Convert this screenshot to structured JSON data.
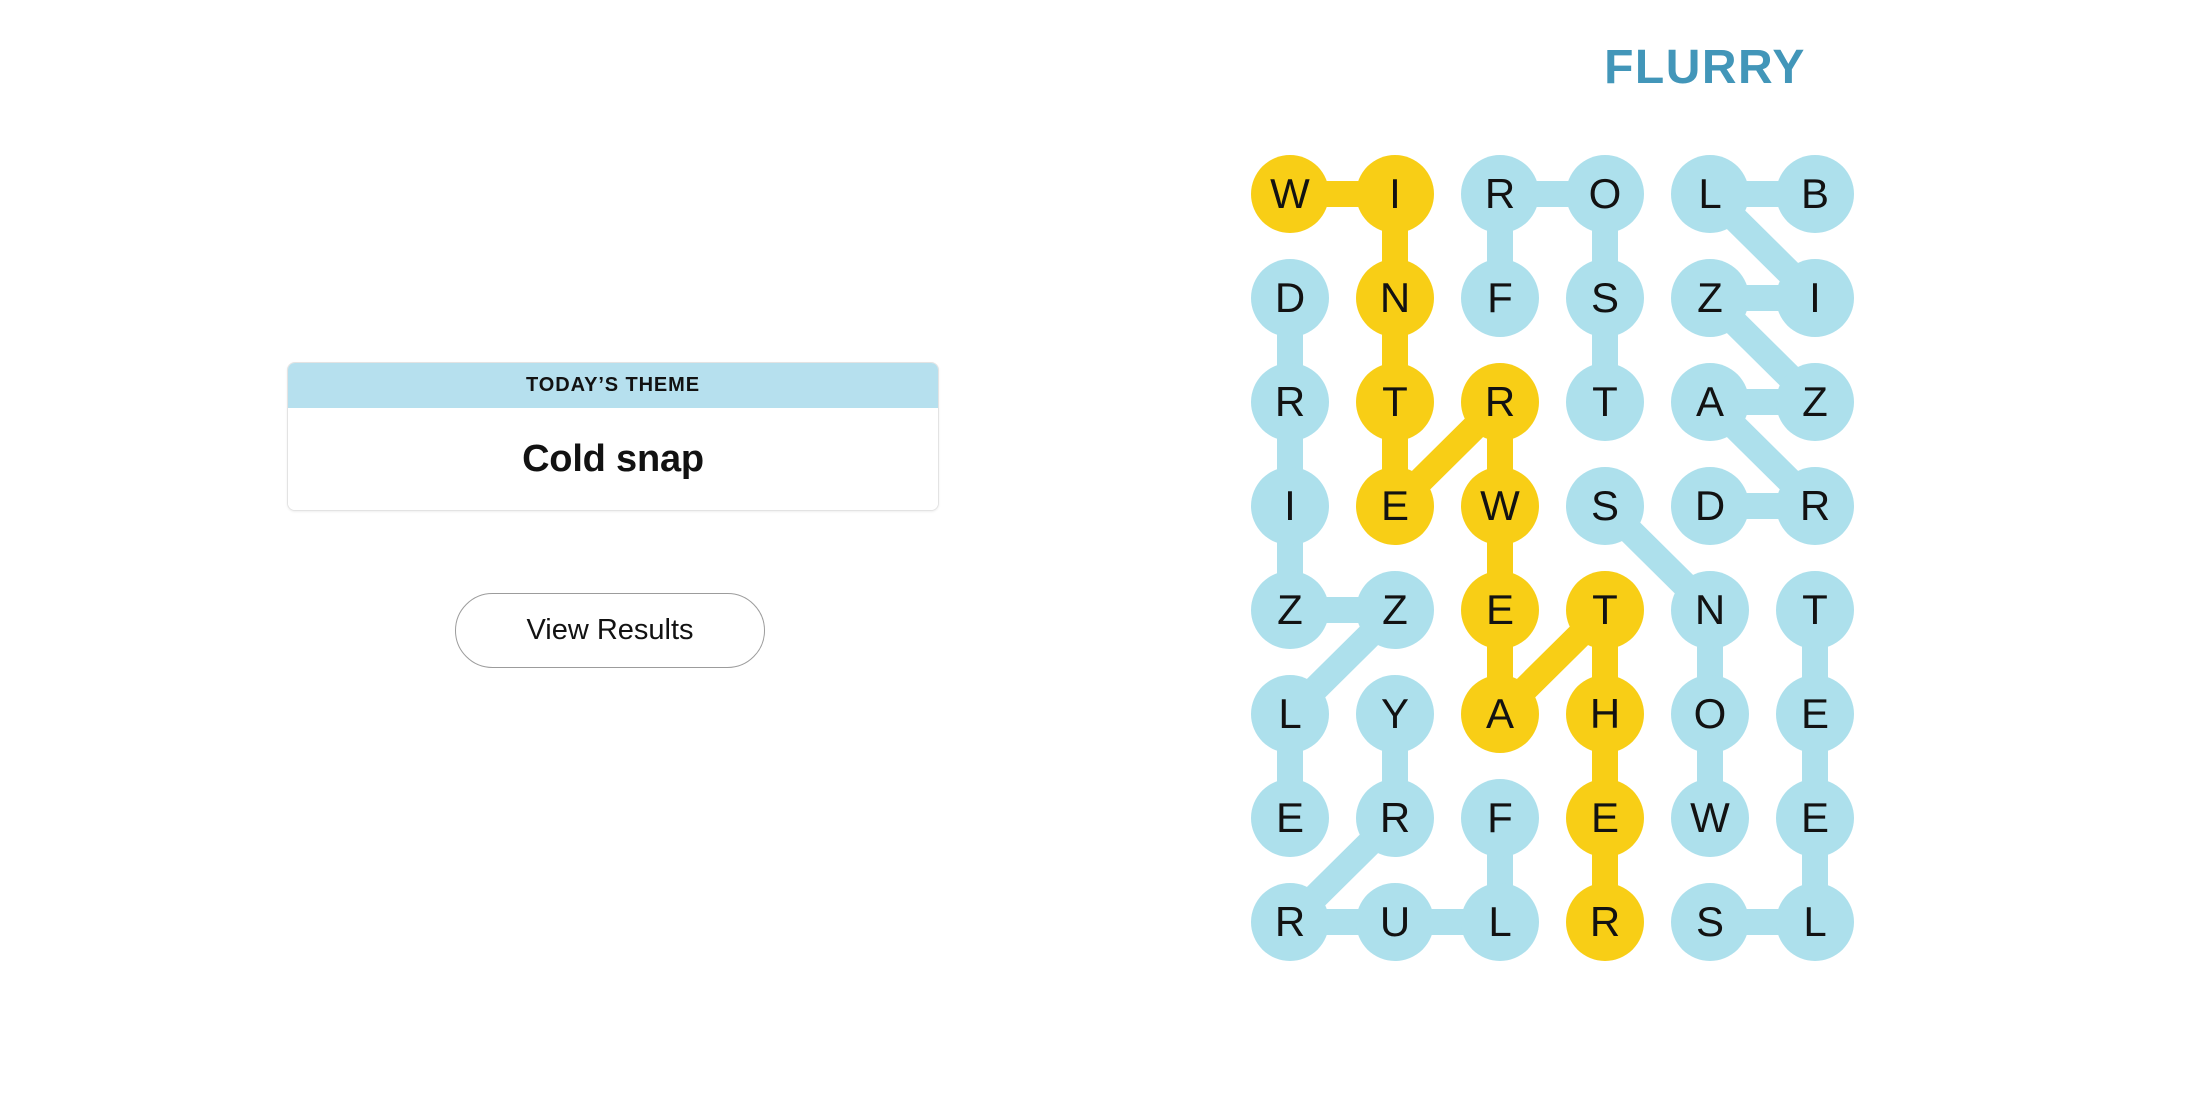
{
  "puzzle": {
    "title": "FLURRY",
    "title_color": "#4296b9",
    "colors": {
      "found_blue": "#ade0ec",
      "theme_yellow": "#f8ce16",
      "header_blue": "#b6e0ee",
      "text": "#121212"
    },
    "grid": {
      "rows": 8,
      "cols": 6,
      "letters": [
        [
          "W",
          "I",
          "R",
          "O",
          "L",
          "B"
        ],
        [
          "D",
          "N",
          "F",
          "S",
          "Z",
          "I"
        ],
        [
          "R",
          "T",
          "R",
          "T",
          "A",
          "Z"
        ],
        [
          "I",
          "E",
          "W",
          "S",
          "D",
          "R"
        ],
        [
          "Z",
          "Z",
          "E",
          "T",
          "N",
          "T"
        ],
        [
          "L",
          "Y",
          "A",
          "H",
          "O",
          "E"
        ],
        [
          "E",
          "R",
          "F",
          "E",
          "W",
          "E"
        ],
        [
          "R",
          "U",
          "L",
          "R",
          "S",
          "L"
        ]
      ],
      "highlight": [
        [
          1,
          1,
          0,
          0,
          0,
          0
        ],
        [
          0,
          1,
          0,
          0,
          0,
          0
        ],
        [
          0,
          1,
          1,
          0,
          0,
          0
        ],
        [
          0,
          1,
          1,
          0,
          0,
          0
        ],
        [
          0,
          0,
          1,
          1,
          0,
          0
        ],
        [
          0,
          0,
          1,
          1,
          0,
          0
        ],
        [
          0,
          0,
          0,
          1,
          0,
          0
        ],
        [
          0,
          0,
          0,
          1,
          0,
          0
        ]
      ],
      "links": [
        {
          "from": [
            0,
            0
          ],
          "to": [
            0,
            1
          ],
          "kind": "theme"
        },
        {
          "from": [
            0,
            1
          ],
          "to": [
            1,
            1
          ],
          "kind": "theme"
        },
        {
          "from": [
            1,
            1
          ],
          "to": [
            2,
            1
          ],
          "kind": "theme"
        },
        {
          "from": [
            2,
            1
          ],
          "to": [
            3,
            1
          ],
          "kind": "theme"
        },
        {
          "from": [
            3,
            1
          ],
          "to": [
            2,
            2
          ],
          "kind": "theme"
        },
        {
          "from": [
            2,
            2
          ],
          "to": [
            3,
            2
          ],
          "kind": "theme"
        },
        {
          "from": [
            3,
            2
          ],
          "to": [
            4,
            2
          ],
          "kind": "theme"
        },
        {
          "from": [
            4,
            2
          ],
          "to": [
            5,
            2
          ],
          "kind": "theme"
        },
        {
          "from": [
            5,
            2
          ],
          "to": [
            4,
            3
          ],
          "kind": "theme"
        },
        {
          "from": [
            4,
            3
          ],
          "to": [
            5,
            3
          ],
          "kind": "theme"
        },
        {
          "from": [
            5,
            3
          ],
          "to": [
            6,
            3
          ],
          "kind": "theme"
        },
        {
          "from": [
            6,
            3
          ],
          "to": [
            7,
            3
          ],
          "kind": "theme"
        },
        {
          "from": [
            0,
            2
          ],
          "to": [
            0,
            3
          ],
          "kind": "found"
        },
        {
          "from": [
            0,
            2
          ],
          "to": [
            1,
            2
          ],
          "kind": "found"
        },
        {
          "from": [
            0,
            3
          ],
          "to": [
            1,
            3
          ],
          "kind": "found"
        },
        {
          "from": [
            1,
            3
          ],
          "to": [
            2,
            3
          ],
          "kind": "found"
        },
        {
          "from": [
            0,
            4
          ],
          "to": [
            0,
            5
          ],
          "kind": "found"
        },
        {
          "from": [
            0,
            4
          ],
          "to": [
            1,
            5
          ],
          "kind": "found"
        },
        {
          "from": [
            1,
            5
          ],
          "to": [
            1,
            4
          ],
          "kind": "found"
        },
        {
          "from": [
            1,
            4
          ],
          "to": [
            2,
            5
          ],
          "kind": "found"
        },
        {
          "from": [
            2,
            5
          ],
          "to": [
            2,
            4
          ],
          "kind": "found"
        },
        {
          "from": [
            2,
            4
          ],
          "to": [
            3,
            5
          ],
          "kind": "found"
        },
        {
          "from": [
            3,
            5
          ],
          "to": [
            3,
            4
          ],
          "kind": "found"
        },
        {
          "from": [
            3,
            3
          ],
          "to": [
            4,
            4
          ],
          "kind": "found"
        },
        {
          "from": [
            4,
            4
          ],
          "to": [
            5,
            4
          ],
          "kind": "found"
        },
        {
          "from": [
            5,
            4
          ],
          "to": [
            6,
            4
          ],
          "kind": "found"
        },
        {
          "from": [
            4,
            5
          ],
          "to": [
            5,
            5
          ],
          "kind": "found"
        },
        {
          "from": [
            5,
            5
          ],
          "to": [
            6,
            5
          ],
          "kind": "found"
        },
        {
          "from": [
            6,
            5
          ],
          "to": [
            7,
            5
          ],
          "kind": "found"
        },
        {
          "from": [
            7,
            4
          ],
          "to": [
            7,
            5
          ],
          "kind": "found"
        },
        {
          "from": [
            1,
            0
          ],
          "to": [
            2,
            0
          ],
          "kind": "found"
        },
        {
          "from": [
            2,
            0
          ],
          "to": [
            3,
            0
          ],
          "kind": "found"
        },
        {
          "from": [
            3,
            0
          ],
          "to": [
            4,
            0
          ],
          "kind": "found"
        },
        {
          "from": [
            4,
            0
          ],
          "to": [
            4,
            1
          ],
          "kind": "found"
        },
        {
          "from": [
            4,
            1
          ],
          "to": [
            5,
            0
          ],
          "kind": "found"
        },
        {
          "from": [
            5,
            0
          ],
          "to": [
            6,
            0
          ],
          "kind": "found"
        },
        {
          "from": [
            5,
            1
          ],
          "to": [
            6,
            1
          ],
          "kind": "found"
        },
        {
          "from": [
            6,
            1
          ],
          "to": [
            7,
            0
          ],
          "kind": "found"
        },
        {
          "from": [
            7,
            0
          ],
          "to": [
            7,
            1
          ],
          "kind": "found"
        },
        {
          "from": [
            7,
            1
          ],
          "to": [
            7,
            2
          ],
          "kind": "found"
        },
        {
          "from": [
            7,
            2
          ],
          "to": [
            6,
            2
          ],
          "kind": "found"
        }
      ]
    }
  },
  "theme_card": {
    "header_label": "TODAY’S THEME",
    "theme_word": "Cold snap"
  },
  "actions": {
    "view_results_label": "View Results"
  }
}
